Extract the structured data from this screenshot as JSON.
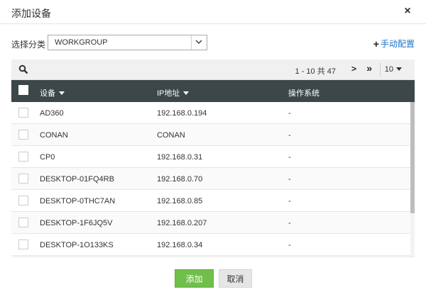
{
  "dialog": {
    "title": "添加设备",
    "close_glyph": "×"
  },
  "filter": {
    "category_label": "选择分类",
    "selected_group": "WORKGROUP",
    "manual_plus": "+",
    "manual_label": "手动配置"
  },
  "toolbar": {
    "pager_text": "1 - 10 共 47",
    "next_glyph": ">",
    "last_glyph": "»",
    "per_page": "10"
  },
  "table": {
    "headers": {
      "device": "设备",
      "ip": "IP地址",
      "os": "操作系统"
    },
    "rows": [
      {
        "device": "AD360",
        "ip": "192.168.0.194",
        "os": "-"
      },
      {
        "device": "CONAN",
        "ip": "CONAN",
        "os": "-"
      },
      {
        "device": "CP0",
        "ip": "192.168.0.31",
        "os": "-"
      },
      {
        "device": "DESKTOP-01FQ4RB",
        "ip": "192.168.0.70",
        "os": "-"
      },
      {
        "device": "DESKTOP-0THC7AN",
        "ip": "192.168.0.85",
        "os": "-"
      },
      {
        "device": "DESKTOP-1F6JQ5V",
        "ip": "192.168.0.207",
        "os": "-"
      },
      {
        "device": "DESKTOP-1O133KS",
        "ip": "192.168.0.34",
        "os": "-"
      }
    ]
  },
  "buttons": {
    "add": "添加",
    "cancel": "取消"
  },
  "colors": {
    "header_bg": "#3d4749",
    "add_green": "#6fbf4a",
    "link_blue": "#1a73c9"
  },
  "icons": {
    "search": "search-icon",
    "close": "close-icon",
    "dropdown": "chevron-down-icon",
    "plus": "plus-icon",
    "sort": "sort-down-icon"
  }
}
